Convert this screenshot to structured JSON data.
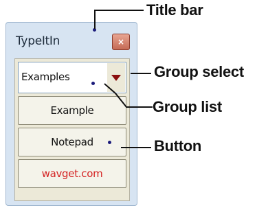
{
  "window": {
    "title": "TypeItIn",
    "close_icon": "close-icon",
    "group_select": {
      "value": "Examples",
      "dropdown_icon": "dropdown-arrow-icon"
    },
    "buttons": [
      {
        "label": "Example"
      },
      {
        "label": "Notepad"
      },
      {
        "label": "wavget.com",
        "color": "#d42222"
      }
    ]
  },
  "callouts": {
    "title_bar": "Title bar",
    "group_select": "Group select",
    "group_list": "Group list",
    "button": "Button"
  }
}
